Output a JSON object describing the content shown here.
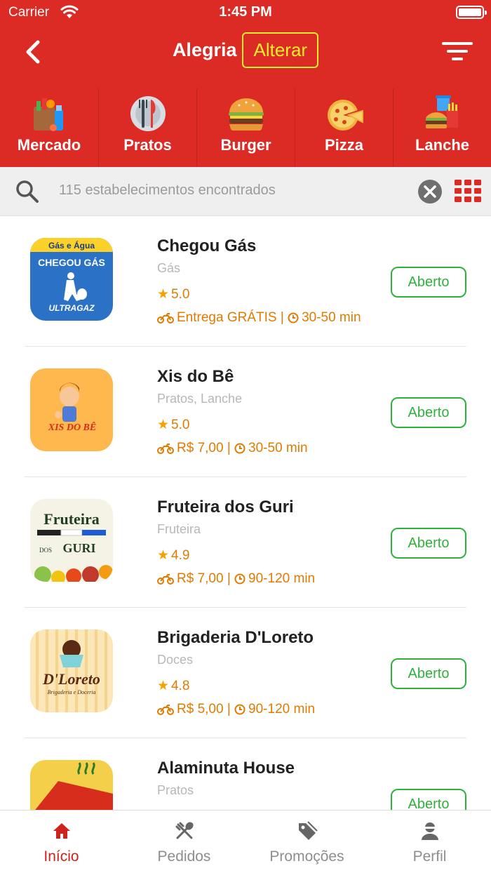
{
  "status_bar": {
    "carrier": "Carrier",
    "time": "1:45 PM"
  },
  "header": {
    "city": "Alegria",
    "change_label": "Alterar"
  },
  "categories": [
    {
      "label": "Mercado",
      "icon": "grocery-bag-icon"
    },
    {
      "label": "Pratos",
      "icon": "plate-cutlery-icon"
    },
    {
      "label": "Burger",
      "icon": "burger-icon"
    },
    {
      "label": "Pizza",
      "icon": "pizza-icon"
    },
    {
      "label": "Lanche",
      "icon": "snack-combo-icon"
    }
  ],
  "search": {
    "placeholder": "115 estabelecimentos encontrados"
  },
  "stores": [
    {
      "name": "Chegou Gás",
      "category": "Gás",
      "rating": "5.0",
      "delivery": "Entrega GRÁTIS",
      "time": "30-50 min",
      "status": "Aberto",
      "logo_text": [
        "Gás e Água",
        "CHEGOU GÁS",
        "ULTRAGAZ"
      ]
    },
    {
      "name": "Xis do Bê",
      "category": "Pratos, Lanche",
      "rating": "5.0",
      "delivery": "R$ 7,00",
      "time": "30-50 min",
      "status": "Aberto",
      "logo_text": [
        "XIS DO BÊ"
      ]
    },
    {
      "name": "Fruteira dos Guri",
      "category": "Fruteira",
      "rating": "4.9",
      "delivery": "R$ 7,00",
      "time": "90-120 min",
      "status": "Aberto",
      "logo_text": [
        "Fruteira",
        "DOS",
        "GURI"
      ]
    },
    {
      "name": "Brigaderia D'Loreto",
      "category": "Doces",
      "rating": "4.8",
      "delivery": "R$ 5,00",
      "time": "90-120 min",
      "status": "Aberto",
      "logo_text": [
        "D'Loreto",
        "Brigaderia e Doceria"
      ]
    },
    {
      "name": "Alaminuta House",
      "category": "Pratos",
      "rating": "",
      "delivery": "",
      "time": "",
      "status": "Aberto",
      "logo_text": []
    }
  ],
  "tabs": [
    {
      "label": "Início",
      "icon": "home-icon",
      "active": true
    },
    {
      "label": "Pedidos",
      "icon": "cutlery-icon",
      "active": false
    },
    {
      "label": "Promoções",
      "icon": "tag-icon",
      "active": false
    },
    {
      "label": "Perfil",
      "icon": "user-icon",
      "active": false
    }
  ],
  "colors": {
    "brand_red": "#dc2a24",
    "accent_yellow": "#ffee2e",
    "open_green": "#2eb23c",
    "delivery_orange": "#e07b00",
    "star": "#f5a200"
  }
}
